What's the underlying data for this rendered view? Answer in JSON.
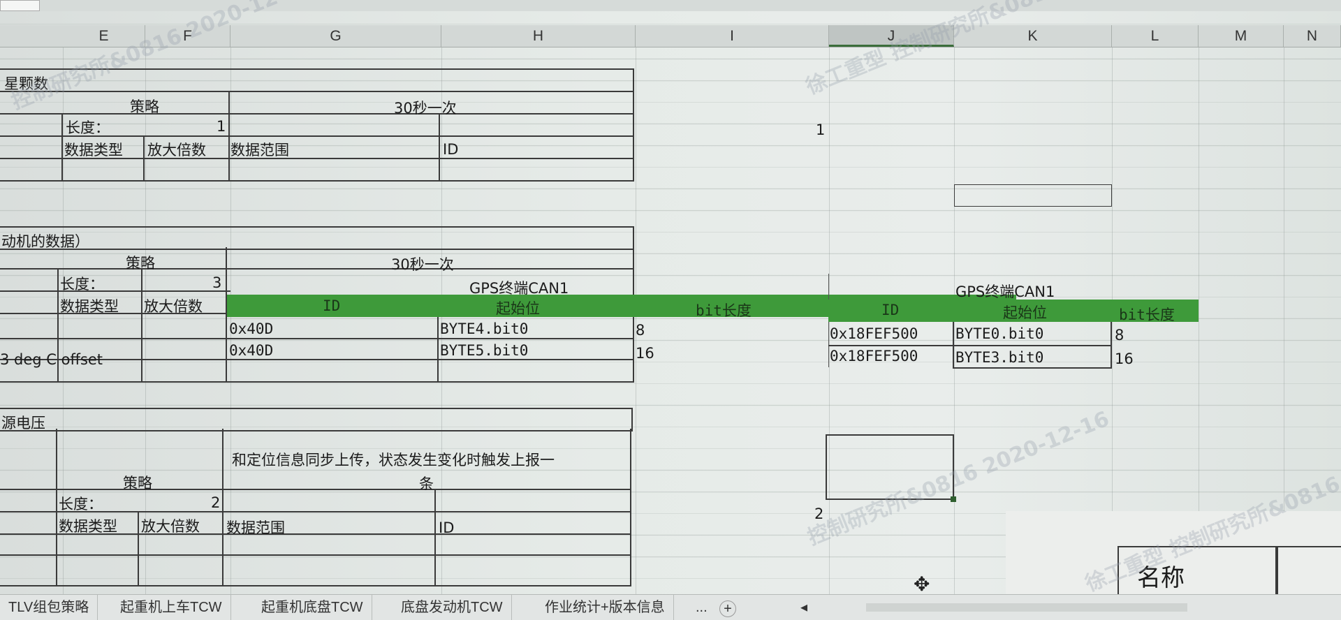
{
  "columns": {
    "E": "E",
    "F": "F",
    "G": "G",
    "H": "H",
    "I": "I",
    "J": "J",
    "K": "K",
    "L": "L",
    "M": "M",
    "N": "N"
  },
  "section1": {
    "title": "星颗数",
    "strategy_label": "策略",
    "strategy_value": "30秒一次",
    "length_label": "长度：",
    "length_value": "1",
    "datatype_label": "数据类型",
    "scale_label": "放大倍数",
    "range_label": "数据范围",
    "id_label": "ID"
  },
  "section2": {
    "title": "动机的数据）",
    "strategy_label": "策略",
    "strategy_value": "30秒一次",
    "length_label": "长度：",
    "length_value": "3",
    "datatype_label": "数据类型",
    "scale_label": "放大倍数",
    "can_title_left": "GPS终端CAN1",
    "can_title_right": "GPS终端CAN1",
    "header_id": "ID",
    "header_start": "起始位",
    "header_bitlen": "bit长度",
    "offset_text": "3 deg C offset",
    "left_rows": [
      {
        "id": "0x40D",
        "start": "BYTE4.bit0",
        "bitlen": "8"
      },
      {
        "id": "0x40D",
        "start": "BYTE5.bit0",
        "bitlen": "16"
      }
    ],
    "right_rows": [
      {
        "id": "0x18FEF500",
        "start": "BYTE0.bit0",
        "bitlen": "8"
      },
      {
        "id": "0x18FEF500",
        "start": "BYTE3.bit0",
        "bitlen": "16"
      }
    ]
  },
  "section3": {
    "title": "源电压",
    "strategy_label": "策略",
    "strategy_value_line1": "和定位信息同步上传，状态发生变化时触发上报一",
    "strategy_value_line2": "条",
    "length_label": "长度：",
    "length_value": "2",
    "datatype_label": "数据类型",
    "scale_label": "放大倍数",
    "range_label": "数据范围",
    "id_label": "ID"
  },
  "side_numbers": {
    "n1": "1",
    "n2": "2"
  },
  "name_box_label": "名称",
  "sheet_tabs": [
    "TLV组包策略",
    "起重机上车TCW",
    "起重机底盘TCW",
    "底盘发动机TCW",
    "作业统计+版本信息"
  ],
  "sheet_tabs_more": "...",
  "add_sheet": "+"
}
